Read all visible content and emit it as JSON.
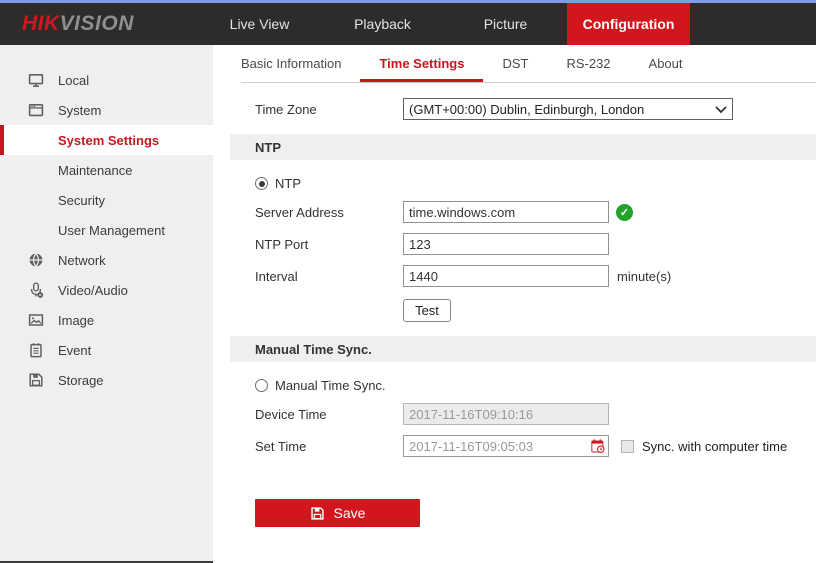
{
  "colors": {
    "accent": "#d2161e",
    "nav_bg": "#2d2c2b",
    "top_strip": "#7d9ce2",
    "sidebar_bg": "#efeff0",
    "valid_green": "#23a32a"
  },
  "topnav": {
    "logo_hik": "HIK",
    "logo_vision": "VISION",
    "items": [
      {
        "label": "Live View",
        "active": false
      },
      {
        "label": "Playback",
        "active": false
      },
      {
        "label": "Picture",
        "active": false
      },
      {
        "label": "Configuration",
        "active": true
      }
    ]
  },
  "sidebar": {
    "items": [
      {
        "label": "Local",
        "icon": "monitor-icon"
      },
      {
        "label": "System",
        "icon": "window-icon"
      },
      {
        "label": "System Settings",
        "active": true
      },
      {
        "label": "Maintenance"
      },
      {
        "label": "Security"
      },
      {
        "label": "User Management"
      },
      {
        "label": "Network",
        "icon": "globe-icon"
      },
      {
        "label": "Video/Audio",
        "icon": "microphone-icon"
      },
      {
        "label": "Image",
        "icon": "image-icon"
      },
      {
        "label": "Event",
        "icon": "event-icon"
      },
      {
        "label": "Storage",
        "icon": "storage-icon"
      }
    ]
  },
  "tabs": [
    {
      "label": "Basic Information",
      "active": false
    },
    {
      "label": "Time Settings",
      "active": true
    },
    {
      "label": "DST",
      "active": false
    },
    {
      "label": "RS-232",
      "active": false
    },
    {
      "label": "About",
      "active": false
    }
  ],
  "form": {
    "time_zone": {
      "label": "Time Zone",
      "value": "(GMT+00:00) Dublin, Edinburgh, London"
    },
    "ntp": {
      "section_title": "NTP",
      "radio_label": "NTP",
      "radio_selected": true,
      "server_address": {
        "label": "Server Address",
        "value": "time.windows.com",
        "status": "valid",
        "status_icon": "check-circle-icon"
      },
      "port": {
        "label": "NTP Port",
        "value": "123"
      },
      "interval": {
        "label": "Interval",
        "value": "1440",
        "unit": "minute(s)"
      },
      "test_button": "Test"
    },
    "manual": {
      "section_title": "Manual Time Sync.",
      "radio_label": "Manual Time Sync.",
      "radio_selected": false,
      "device_time": {
        "label": "Device Time",
        "value": "2017-11-16T09:10:16",
        "readonly": true
      },
      "set_time": {
        "label": "Set Time",
        "value": "2017-11-16T09:05:03",
        "picker_icon": "calendar-icon"
      },
      "sync_checkbox": {
        "label": "Sync. with computer time",
        "checked": false
      }
    },
    "save_button": "Save"
  }
}
